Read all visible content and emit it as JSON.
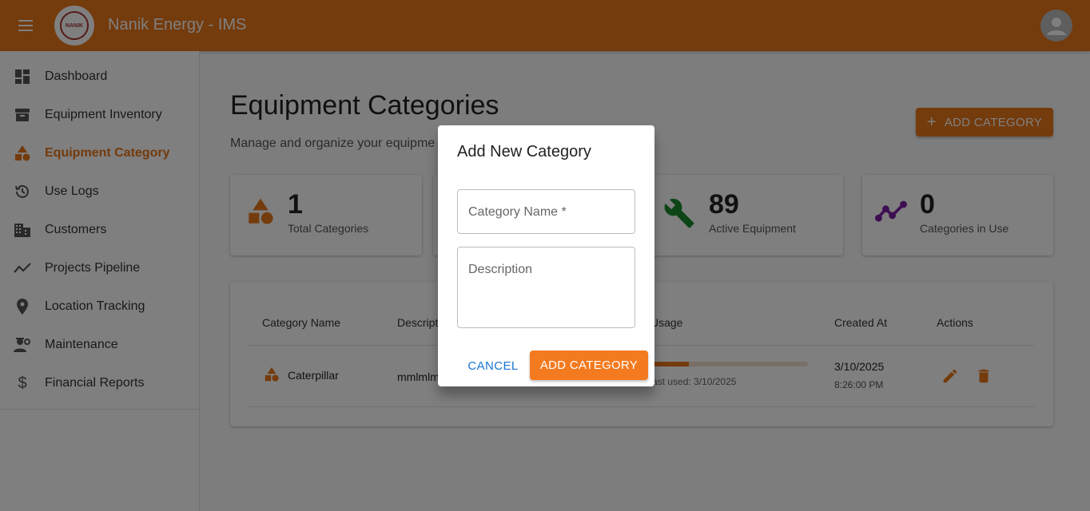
{
  "app": {
    "title": "Nanik Energy - IMS",
    "logo_text": "NANIK"
  },
  "colors": {
    "brand": "#e8771a",
    "link": "#1976d2",
    "purple": "#7b1fa2",
    "green": "#1b8a2e"
  },
  "sidebar": {
    "items": [
      {
        "label": "Dashboard",
        "icon": "dashboard-icon"
      },
      {
        "label": "Equipment Inventory",
        "icon": "archive-icon"
      },
      {
        "label": "Equipment Category",
        "icon": "category-icon",
        "active": true
      },
      {
        "label": "Use Logs",
        "icon": "history-icon"
      },
      {
        "label": "Customers",
        "icon": "business-icon"
      },
      {
        "label": "Projects Pipeline",
        "icon": "trend-icon"
      },
      {
        "label": "Location Tracking",
        "icon": "location-pin-icon"
      },
      {
        "label": "Maintenance",
        "icon": "engineering-icon"
      },
      {
        "label": "Financial Reports",
        "icon": "dollar-icon"
      }
    ]
  },
  "main": {
    "title": "Equipment Categories",
    "subtitle": "Manage and organize your equipme",
    "add_button": "ADD CATEGORY",
    "stats": [
      {
        "value": "1",
        "label": "Total Categories",
        "icon": "category-icon"
      },
      {
        "value": "89",
        "label": "Active Equipment",
        "icon": "wrench-icon"
      },
      {
        "value": "0",
        "label": "Categories in Use",
        "icon": "trend-icon"
      }
    ],
    "table": {
      "headers": [
        "Category Name",
        "Descripti",
        "Usage",
        "Created At",
        "Actions"
      ],
      "rows": [
        {
          "name": "Caterpillar",
          "description": "mmlmlm",
          "usage_fraction": 0.3,
          "last_used": "ast used: 3/10/2025",
          "created_date": "3/10/2025",
          "created_time": "8:26:00 PM"
        }
      ]
    }
  },
  "dialog": {
    "title": "Add New Category",
    "name_placeholder": "Category Name *",
    "description_placeholder": "Description",
    "cancel": "CANCEL",
    "submit": "ADD CATEGORY"
  }
}
